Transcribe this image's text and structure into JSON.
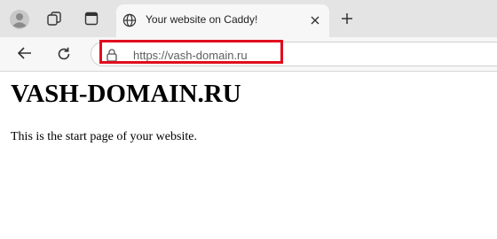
{
  "browser": {
    "tab": {
      "title": "Your website on Caddy!"
    },
    "address_bar": {
      "url": "https://vash-domain.ru"
    },
    "icons": {
      "profile": "profile-avatar-icon",
      "workspaces": "workspaces-icon",
      "tab_actions": "tab-actions-icon",
      "tab_favicon": "globe-icon",
      "close_tab": "close-icon",
      "new_tab": "plus-icon",
      "back": "back-arrow-icon",
      "refresh": "refresh-icon",
      "site_info": "lock-icon"
    },
    "highlight_color": "#e00d1e"
  },
  "page": {
    "heading": "VASH-DOMAIN.RU",
    "text": "This is the start page of your website."
  }
}
